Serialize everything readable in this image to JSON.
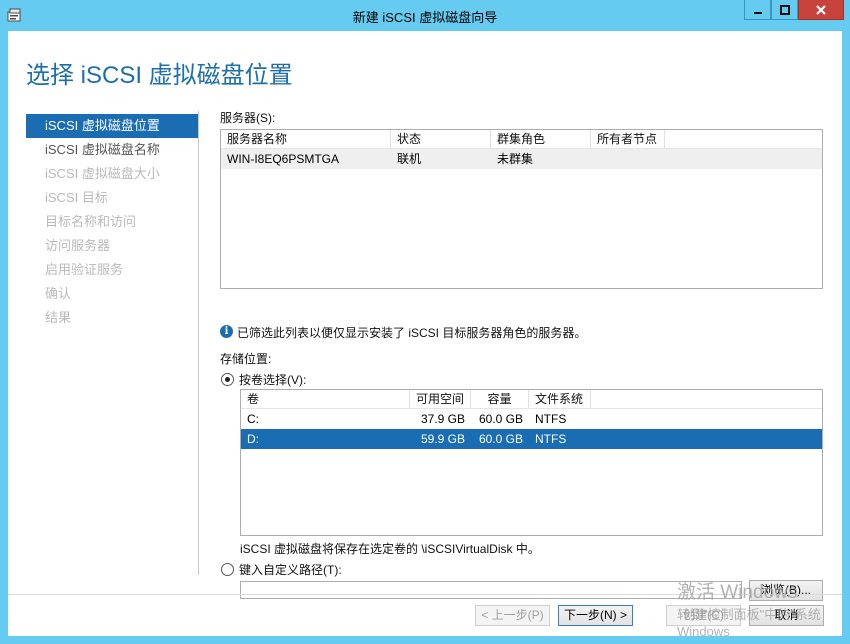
{
  "window": {
    "title": "新建 iSCSI 虚拟磁盘向导",
    "controls": {
      "minimize": "minimize-icon",
      "maximize": "maximize-icon",
      "close": "close-icon"
    }
  },
  "page_title": "选择 iSCSI 虚拟磁盘位置",
  "nav": {
    "items": [
      {
        "label": "iSCSI 虚拟磁盘位置",
        "state": "active"
      },
      {
        "label": "iSCSI 虚拟磁盘名称",
        "state": "enabled"
      },
      {
        "label": "iSCSI 虚拟磁盘大小",
        "state": "disabled"
      },
      {
        "label": "iSCSI 目标",
        "state": "disabled"
      },
      {
        "label": "目标名称和访问",
        "state": "disabled"
      },
      {
        "label": "访问服务器",
        "state": "disabled"
      },
      {
        "label": "启用验证服务",
        "state": "disabled"
      },
      {
        "label": "确认",
        "state": "disabled"
      },
      {
        "label": "结果",
        "state": "disabled"
      }
    ]
  },
  "servers": {
    "label": "服务器(S):",
    "columns": [
      "服务器名称",
      "状态",
      "群集角色",
      "所有者节点"
    ],
    "rows": [
      {
        "name": "WIN-I8EQ6PSMTGA",
        "status": "联机",
        "cluster_role": "未群集",
        "owner_node": ""
      }
    ],
    "info": "已筛选此列表以便仅显示安装了 iSCSI 目标服务器角色的服务器。"
  },
  "storage": {
    "label": "存储位置:",
    "by_volume_label": "按卷选择(V):",
    "by_volume_checked": true,
    "columns": [
      "卷",
      "可用空间",
      "容量",
      "文件系统"
    ],
    "rows": [
      {
        "volume": "C:",
        "free": "37.9 GB",
        "capacity": "60.0 GB",
        "fs": "NTFS",
        "selected": false
      },
      {
        "volume": "D:",
        "free": "59.9 GB",
        "capacity": "60.0 GB",
        "fs": "NTFS",
        "selected": true
      }
    ],
    "save_note": "iSCSI 虚拟磁盘将保存在选定卷的 \\iSCSIVirtualDisk 中。",
    "custom_path_label": "键入自定义路径(T):",
    "custom_path_value": "",
    "browse_label": "浏览(B)..."
  },
  "footer": {
    "prev": "< 上一步(P)",
    "next": "下一步(N) >",
    "create": "创建(C)",
    "cancel": "取消"
  },
  "watermark": {
    "line1": "激活 Windows",
    "line2": "转到\"控制面板\"中的\"系统",
    "line3": "Windows"
  },
  "colors": {
    "accent": "#1a6db3",
    "title_blue": "#1e6fa8",
    "frame": "#66cbf0",
    "close": "#c7423a"
  }
}
